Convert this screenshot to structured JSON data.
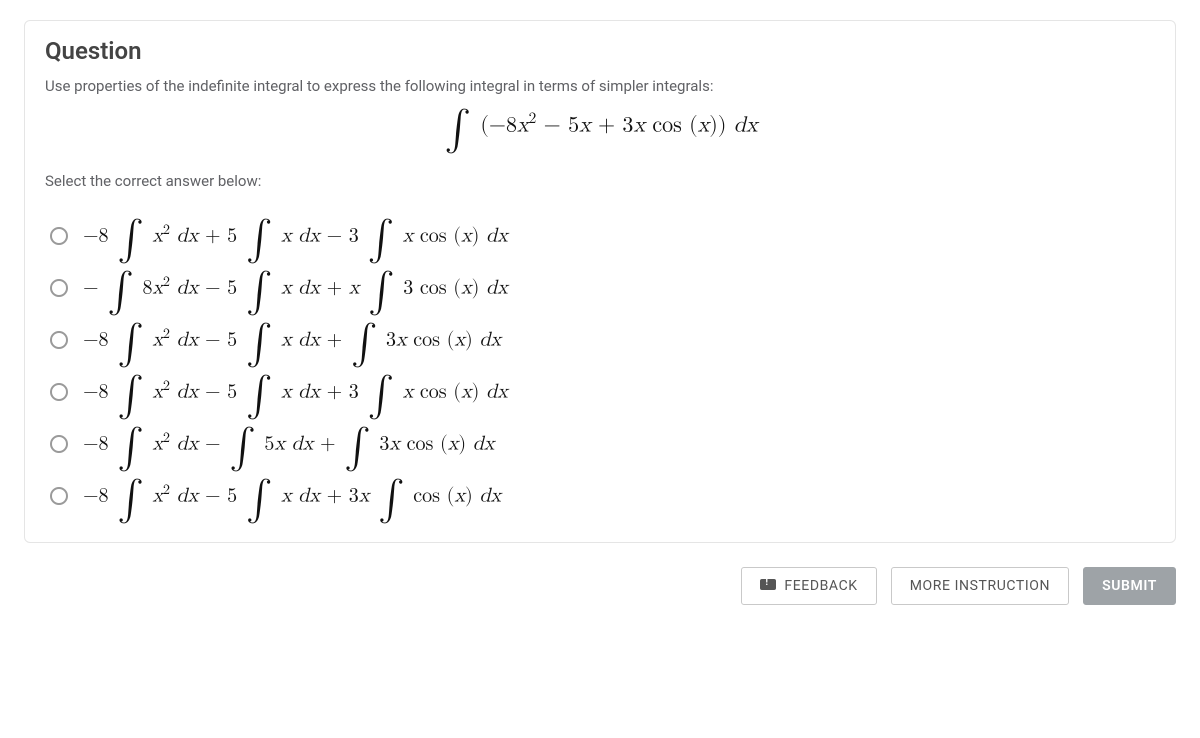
{
  "question": {
    "title": "Question",
    "prompt": "Use properties of the indefinite integral to express the following integral in terms of simpler integrals:",
    "integral_html": "<span class=\"intg\">∫</span> (−8<i>x</i><span class=\"sup\">2</span> − 5<i>x</i> + 3<i>x</i> cos (<i>x</i>)) <i>dx</i>",
    "select_label": "Select the correct answer below:"
  },
  "options": [
    {
      "html": "−8 <span class=\"intg\">∫</span> <i>x</i><span class=\"sup\">2</span> <i>dx</i> + 5 <span class=\"intg\">∫</span> <i>x</i> <i>dx</i> − 3 <span class=\"intg\">∫</span> <i>x</i> cos (<i>x</i>) <i>dx</i>"
    },
    {
      "html": "− <span class=\"intg\">∫</span> 8<i>x</i><span class=\"sup\">2</span> <i>dx</i> − 5 <span class=\"intg\">∫</span> <i>x</i> <i>dx</i> + <i>x</i> <span class=\"intg\">∫</span> 3 cos (<i>x</i>) <i>dx</i>"
    },
    {
      "html": "−8 <span class=\"intg\">∫</span> <i>x</i><span class=\"sup\">2</span> <i>dx</i> − 5 <span class=\"intg\">∫</span> <i>x</i> <i>dx</i> + <span class=\"intg\">∫</span> 3<i>x</i> cos (<i>x</i>) <i>dx</i>"
    },
    {
      "html": "−8 <span class=\"intg\">∫</span> <i>x</i><span class=\"sup\">2</span> <i>dx</i> − 5 <span class=\"intg\">∫</span> <i>x</i> <i>dx</i> + 3 <span class=\"intg\">∫</span> <i>x</i> cos (<i>x</i>) <i>dx</i>"
    },
    {
      "html": "−8 <span class=\"intg\">∫</span> <i>x</i><span class=\"sup\">2</span> <i>dx</i> − <span class=\"intg\">∫</span> 5<i>x</i> <i>dx</i> + <span class=\"intg\">∫</span> 3<i>x</i> cos (<i>x</i>) <i>dx</i>"
    },
    {
      "html": "−8 <span class=\"intg\">∫</span> <i>x</i><span class=\"sup\">2</span> <i>dx</i> − 5 <span class=\"intg\">∫</span> <i>x</i> <i>dx</i> + 3<i>x</i> <span class=\"intg\">∫</span> cos (<i>x</i>) <i>dx</i>"
    }
  ],
  "buttons": {
    "feedback": "FEEDBACK",
    "more": "MORE INSTRUCTION",
    "submit": "SUBMIT"
  }
}
